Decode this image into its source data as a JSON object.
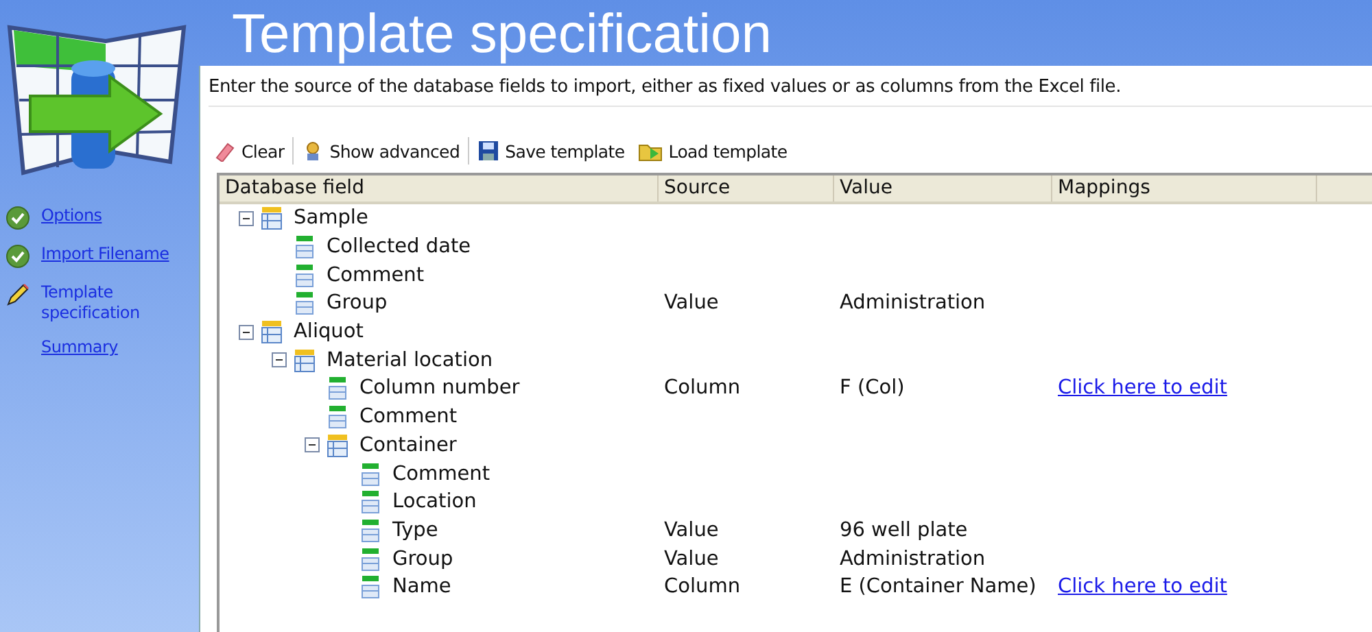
{
  "header": {
    "title": "Template specification"
  },
  "sidebar": {
    "steps": [
      {
        "label": "Options",
        "kind": "done"
      },
      {
        "label": "Import Filename",
        "kind": "done"
      },
      {
        "label": "Template specification",
        "kind": "current"
      },
      {
        "label": "Summary",
        "kind": "todo"
      }
    ]
  },
  "description": "Enter the source of the database fields to import, either as fixed values or as columns from the Excel file.",
  "toolbar": [
    {
      "label": "Clear",
      "kind": "clear"
    },
    {
      "label": "Show advanced",
      "kind": "advanced"
    },
    {
      "label": "Save template",
      "kind": "save"
    },
    {
      "label": "Load template",
      "kind": "load"
    }
  ],
  "table": {
    "columns": [
      "Database field",
      "Source",
      "Value",
      "Mappings"
    ],
    "rows": [
      {
        "kind": "group",
        "name": "Sample",
        "expanded": true,
        "children": [
          {
            "kind": "field",
            "name": "Collected date"
          },
          {
            "kind": "field",
            "name": "Comment"
          },
          {
            "kind": "field",
            "name": "Group",
            "source": "Value",
            "value": "Administration"
          }
        ]
      },
      {
        "kind": "group",
        "name": "Aliquot",
        "expanded": true,
        "children": [
          {
            "kind": "group",
            "name": "Material location",
            "expanded": true,
            "children": [
              {
                "kind": "field",
                "name": "Column number",
                "source": "Column",
                "value": "F (Col)",
                "mapping": "Click here to edit"
              },
              {
                "kind": "field",
                "name": "Comment"
              },
              {
                "kind": "group",
                "name": "Container",
                "expanded": true,
                "children": [
                  {
                    "kind": "field",
                    "name": "Comment"
                  },
                  {
                    "kind": "field",
                    "name": "Location"
                  },
                  {
                    "kind": "field",
                    "name": "Type",
                    "source": "Value",
                    "value": "96 well plate"
                  },
                  {
                    "kind": "field",
                    "name": "Group",
                    "source": "Value",
                    "value": "Administration"
                  },
                  {
                    "kind": "field",
                    "name": "Name",
                    "source": "Column",
                    "value": "E (Container Name)",
                    "mapping": "Click here to edit"
                  }
                ]
              }
            ]
          }
        ]
      }
    ]
  }
}
